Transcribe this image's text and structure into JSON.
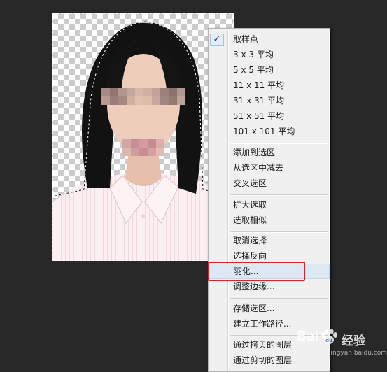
{
  "menu": {
    "checked_item": "取样点",
    "groups": [
      [
        "取样点",
        "3 x 3 平均",
        "5 x 5 平均",
        "11 x 11 平均",
        "31 x 31 平均",
        "51 x 51 平均",
        "101 x 101 平均"
      ],
      [
        "添加到选区",
        "从选区中减去",
        "交叉选区"
      ],
      [
        "扩大选取",
        "选取相似"
      ],
      [
        "取消选择",
        "选择反向",
        "羽化...",
        "调整边缘..."
      ],
      [
        "存储选区...",
        "建立工作路径..."
      ],
      [
        "通过拷贝的图层",
        "通过剪切的图层"
      ]
    ],
    "highlighted_item": "羽化...",
    "check_glyph": "✓"
  },
  "watermark": {
    "logo_text": "Bai",
    "logo_suffix": "经验",
    "url": "jingyan.baidu.com"
  },
  "colors": {
    "background": "#282828",
    "menu_bg": "#f0f0f0",
    "highlight_box": "#e02222"
  },
  "icons": [
    "check-icon",
    "baidu-paw-icon"
  ]
}
